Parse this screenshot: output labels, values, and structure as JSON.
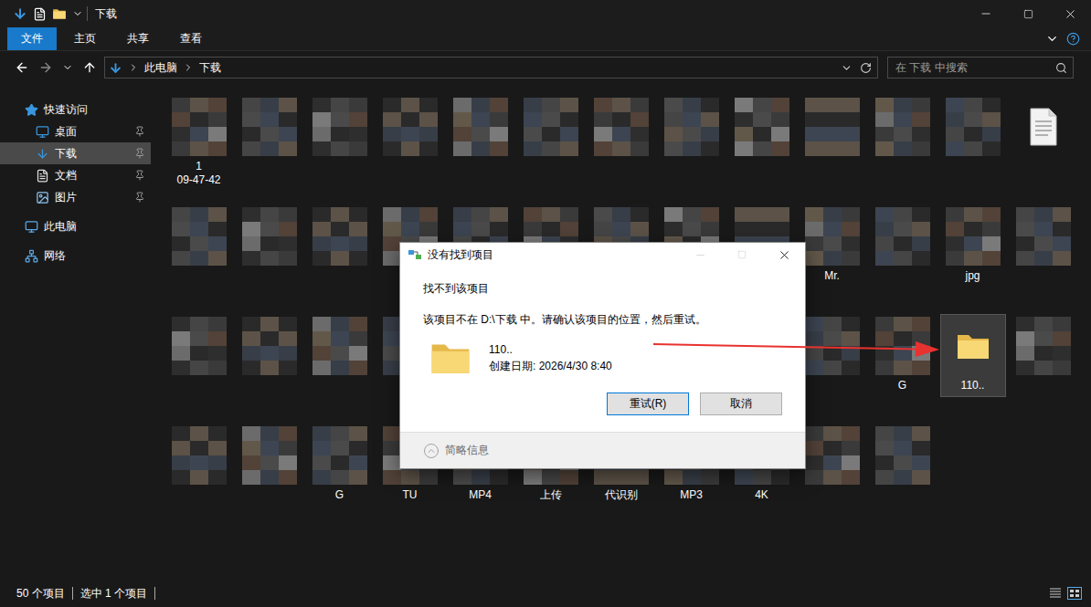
{
  "window": {
    "title": "下载"
  },
  "ribbon": {
    "tabs": [
      {
        "label": "文件",
        "selected": true
      },
      {
        "label": "主页",
        "selected": false
      },
      {
        "label": "共享",
        "selected": false
      },
      {
        "label": "查看",
        "selected": false
      }
    ]
  },
  "address": {
    "crumbs": [
      "此电脑",
      "下载"
    ]
  },
  "search": {
    "placeholder": "在 下载 中搜索"
  },
  "sidebar": {
    "items": [
      {
        "label": "快速访问",
        "kind": "star",
        "pinned": false,
        "selected": false,
        "children": [
          {
            "label": "桌面",
            "kind": "desktop",
            "pinned": true,
            "selected": false
          },
          {
            "label": "下载",
            "kind": "download",
            "pinned": true,
            "selected": true
          },
          {
            "label": "文档",
            "kind": "document",
            "pinned": true,
            "selected": false
          },
          {
            "label": "图片",
            "kind": "picture",
            "pinned": true,
            "selected": false
          }
        ]
      },
      {
        "label": "此电脑",
        "kind": "pc",
        "pinned": false,
        "selected": false
      },
      {
        "label": "网络",
        "kind": "network",
        "pinned": false,
        "selected": false
      }
    ]
  },
  "files": {
    "items": [
      {
        "kind": "thumb",
        "label": "1\n09-47-42",
        "selected": false
      },
      {
        "kind": "thumb",
        "selected": false
      },
      {
        "kind": "thumb",
        "selected": false
      },
      {
        "kind": "thumb",
        "selected": false
      },
      {
        "kind": "thumb",
        "selected": false
      },
      {
        "kind": "thumb",
        "selected": false
      },
      {
        "kind": "thumb",
        "selected": false
      },
      {
        "kind": "thumb",
        "selected": false
      },
      {
        "kind": "thumb",
        "selected": false
      },
      {
        "kind": "thumb",
        "selected": false
      },
      {
        "kind": "thumb",
        "selected": false
      },
      {
        "kind": "thumb",
        "selected": false
      },
      {
        "kind": "doc",
        "selected": false
      },
      {
        "kind": "thumb",
        "selected": false
      },
      {
        "kind": "thumb",
        "selected": false
      },
      {
        "kind": "thumb",
        "selected": false
      },
      {
        "kind": "thumb",
        "selected": false
      },
      {
        "kind": "thumb",
        "selected": false
      },
      {
        "kind": "thumb",
        "selected": false
      },
      {
        "kind": "thumb",
        "selected": false
      },
      {
        "kind": "thumb",
        "selected": false
      },
      {
        "kind": "thumb",
        "selected": false
      },
      {
        "kind": "thumb",
        "label": "Mr.",
        "selected": false
      },
      {
        "kind": "thumb",
        "selected": false
      },
      {
        "kind": "thumb",
        "label": "jpg",
        "selected": false
      },
      {
        "kind": "thumb",
        "selected": false
      },
      {
        "kind": "thumb",
        "selected": false
      },
      {
        "kind": "thumb",
        "selected": false
      },
      {
        "kind": "thumb",
        "selected": false
      },
      {
        "kind": "thumb",
        "selected": false
      },
      {
        "kind": "thumb",
        "selected": false
      },
      {
        "kind": "thumb",
        "selected": false
      },
      {
        "kind": "thumb",
        "selected": false
      },
      {
        "kind": "thumb",
        "selected": false
      },
      {
        "kind": "thumb",
        "selected": false
      },
      {
        "kind": "thumb",
        "selected": false
      },
      {
        "kind": "thumb",
        "label": "G",
        "selected": false
      },
      {
        "kind": "folder",
        "label": "110..",
        "selected": true
      },
      {
        "kind": "thumb",
        "selected": false
      },
      {
        "kind": "thumb",
        "selected": false
      },
      {
        "kind": "thumb",
        "selected": false
      },
      {
        "kind": "thumb",
        "label": "G",
        "selected": false
      },
      {
        "kind": "thumb",
        "label": "TU",
        "selected": false
      },
      {
        "kind": "thumb",
        "label": "MP4",
        "selected": false
      },
      {
        "kind": "thumb",
        "label": "上传",
        "selected": false
      },
      {
        "kind": "thumb",
        "label": "代识别",
        "selected": false
      },
      {
        "kind": "thumb",
        "label": "MP3",
        "selected": false
      },
      {
        "kind": "thumb",
        "label": "4K",
        "selected": false
      },
      {
        "kind": "thumb",
        "selected": false
      },
      {
        "kind": "thumb",
        "selected": false
      }
    ]
  },
  "dialog": {
    "title": "没有找到项目",
    "heading": "找不到该项目",
    "message": "该项目不在 D:\\下载 中。请确认该项目的位置，然后重试。",
    "item": {
      "name": "110..",
      "created": "创建日期: 2026/4/30 8:40"
    },
    "buttons": [
      {
        "label": "重试(R)",
        "default": true
      },
      {
        "label": "取消",
        "default": false
      }
    ],
    "details": "简略信息"
  },
  "status_bar": {
    "count": "50 个项目",
    "selection": "选中 1 个项目"
  }
}
